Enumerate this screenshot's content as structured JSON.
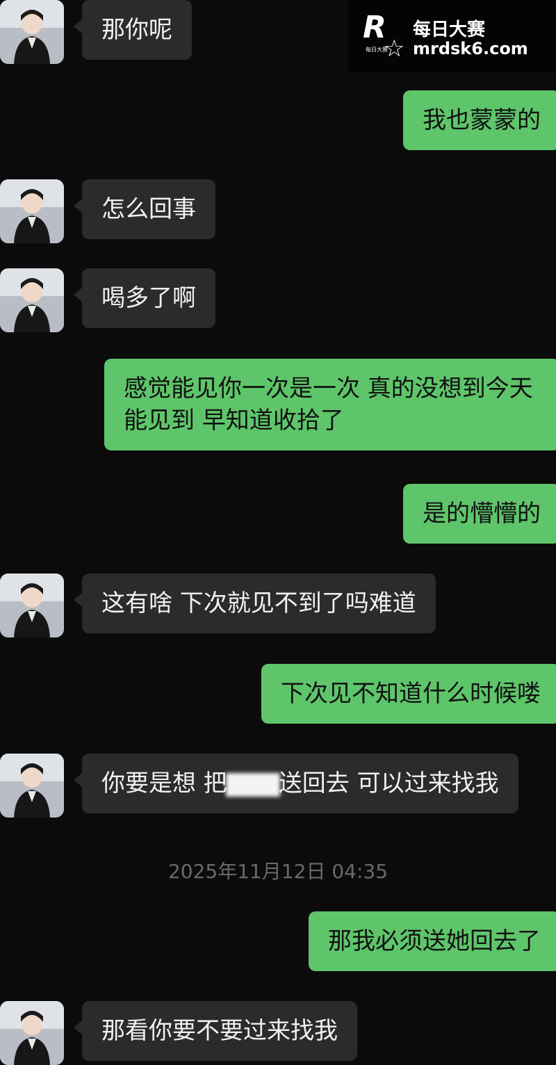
{
  "watermark": {
    "brand_cn": "每日大赛",
    "url": "mrdsk6.com",
    "logo_letter": "R",
    "logo_small_text": "每日大赛"
  },
  "messages": [
    {
      "side": "in",
      "text": "那你呢"
    },
    {
      "side": "out",
      "text": "我也蒙蒙的"
    },
    {
      "side": "in",
      "text": "怎么回事"
    },
    {
      "side": "in",
      "text": "喝多了啊"
    },
    {
      "side": "out",
      "text": "感觉能见你一次是一次 真的没想到今天能见到 早知道收拾了"
    },
    {
      "side": "out",
      "text": "是的懵懵的"
    },
    {
      "side": "in",
      "text": "这有啥 下次就见不到了吗难道"
    },
    {
      "side": "out",
      "text": "下次见不知道什么时候喽"
    },
    {
      "side": "in",
      "text_before": "你要是想 把",
      "text_after": "送回去 可以过来找我"
    },
    {
      "side": "out",
      "text": "那我必须送她回去了"
    },
    {
      "side": "in",
      "text": "那看你要不要过来找我"
    }
  ],
  "timestamp": "2025年11月12日 04:35",
  "colors": {
    "background": "#0b0b0b",
    "incoming_bubble": "#2b2b2b",
    "outgoing_bubble": "#5ec56a"
  }
}
